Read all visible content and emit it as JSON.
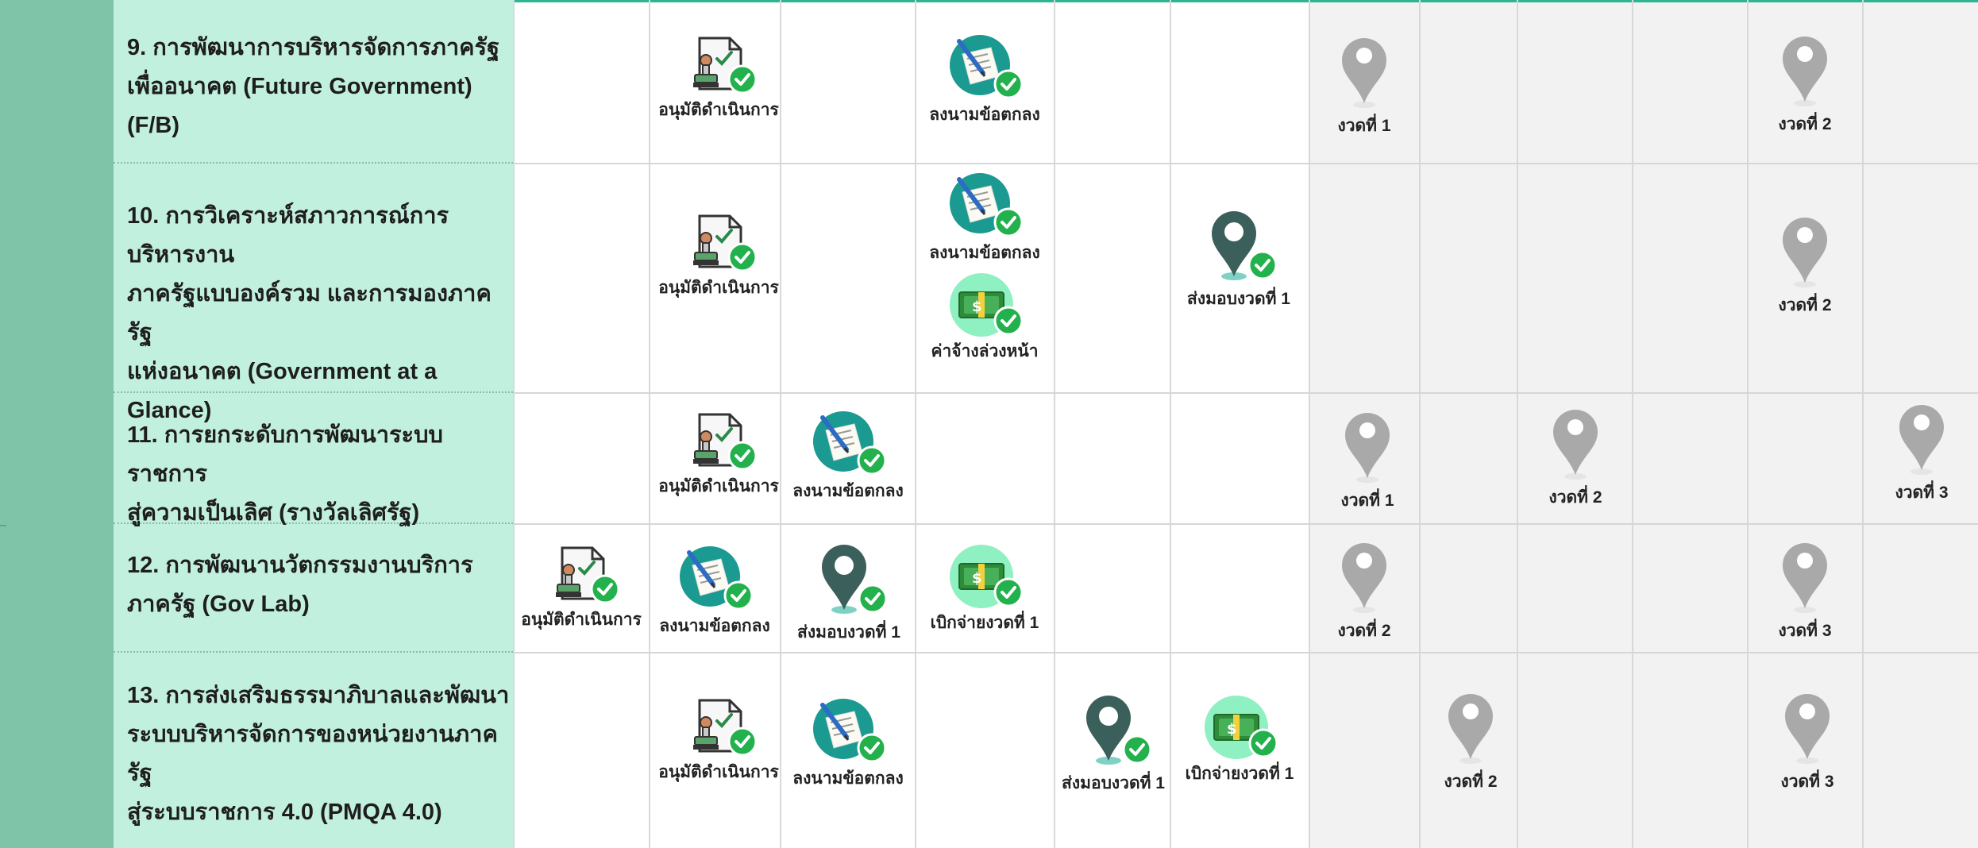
{
  "colors": {
    "accent": "#2bb592",
    "left_strip": "#7fc4a8",
    "title_column": "#c2f0df",
    "future_zone": "#f2f2f2",
    "check": "#22b14c",
    "pin_done": "#3b5f5a",
    "pin_pending": "#a9a9a9"
  },
  "rows": [
    {
      "title_lines": [
        "9. การพัฒนาการบริหารจัดการภาครัฐ",
        "เพื่ออนาคต (Future Government)",
        "(F/B)"
      ],
      "items": [
        {
          "icon": "approval-document-icon",
          "label": "อนุมัติดำเนินการ"
        },
        {
          "icon": "signed-contract-icon",
          "label": "ลงนามข้อตกลง"
        },
        {
          "icon": "pending-pin-icon",
          "label": "งวดที่ 1"
        },
        {
          "icon": "pending-pin-icon",
          "label": "งวดที่ 2"
        }
      ]
    },
    {
      "title_lines": [
        "10. การวิเคราะห์สภาวการณ์การบริหารงาน",
        "ภาครัฐแบบองค์รวม และการมองภาครัฐ",
        "แห่งอนาคต (Government at a Glance)"
      ],
      "items": [
        {
          "icon": "approval-document-icon",
          "label": "อนุมัติดำเนินการ"
        },
        {
          "icon": "signed-contract-icon",
          "label": "ลงนามข้อตกลง"
        },
        {
          "icon": "money-payment-icon",
          "label": "ค่าจ้างล่วงหน้า"
        },
        {
          "icon": "delivered-pin-icon",
          "label": "ส่งมอบงวดที่ 1"
        },
        {
          "icon": "pending-pin-icon",
          "label": "งวดที่ 2"
        }
      ]
    },
    {
      "title_lines": [
        "11. การยกระดับการพัฒนาระบบราชการ",
        "สู่ความเป็นเลิศ (รางวัลเลิศรัฐ)"
      ],
      "items": [
        {
          "icon": "approval-document-icon",
          "label": "อนุมัติดำเนินการ"
        },
        {
          "icon": "signed-contract-icon",
          "label": "ลงนามข้อตกลง"
        },
        {
          "icon": "pending-pin-icon",
          "label": "งวดที่ 1"
        },
        {
          "icon": "pending-pin-icon",
          "label": "งวดที่ 2"
        },
        {
          "icon": "pending-pin-icon",
          "label": "งวดที่ 3"
        }
      ]
    },
    {
      "title_lines": [
        "12. การพัฒนานวัตกรรมงานบริการ",
        "ภาครัฐ (Gov Lab)"
      ],
      "items": [
        {
          "icon": "approval-document-icon",
          "label": "อนุมัติดำเนินการ"
        },
        {
          "icon": "signed-contract-icon",
          "label": "ลงนามข้อตกลง"
        },
        {
          "icon": "delivered-pin-icon",
          "label": "ส่งมอบงวดที่ 1"
        },
        {
          "icon": "money-payment-icon",
          "label": "เบิกจ่ายงวดที่ 1"
        },
        {
          "icon": "pending-pin-icon",
          "label": "งวดที่ 2"
        },
        {
          "icon": "pending-pin-icon",
          "label": "งวดที่ 3"
        }
      ]
    },
    {
      "title_lines": [
        "13. การส่งเสริมธรรมาภิบาลและพัฒนา",
        "ระบบบริหารจัดการของหน่วยงานภาครัฐ",
        "สู่ระบบราชการ 4.0 (PMQA 4.0)"
      ],
      "items": [
        {
          "icon": "approval-document-icon",
          "label": "อนุมัติดำเนินการ"
        },
        {
          "icon": "signed-contract-icon",
          "label": "ลงนามข้อตกลง"
        },
        {
          "icon": "delivered-pin-icon",
          "label": "ส่งมอบงวดที่ 1"
        },
        {
          "icon": "money-payment-icon",
          "label": "เบิกจ่ายงวดที่ 1"
        },
        {
          "icon": "pending-pin-icon",
          "label": "งวดที่ 2"
        },
        {
          "icon": "pending-pin-icon",
          "label": "งวดที่ 3"
        }
      ]
    }
  ]
}
